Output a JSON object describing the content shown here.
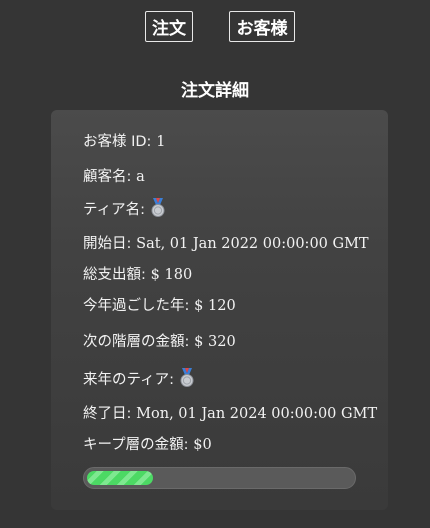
{
  "nav": {
    "orders_label": "注文",
    "customers_label": "お客様"
  },
  "page_title": "注文詳細",
  "details": {
    "customer_id_label": "お客様 ID:",
    "customer_id_value": "1",
    "customer_name_label": "顧客名:",
    "customer_name_value": "a",
    "tier_label": "ティア名:",
    "tier_icon": "silver-medal-icon",
    "start_date_label": "開始日:",
    "start_date_value": "Sat, 01 Jan 2022 00:00:00 GMT",
    "total_spent_label": "総支出額:",
    "total_spent_value": "$ 180",
    "spent_this_year_label": "今年過ごした年:",
    "spent_this_year_value": "$ 120",
    "next_tier_amount_label": "次の階層の金額:",
    "next_tier_amount_value": "$ 320",
    "next_year_tier_label": "来年のティア:",
    "next_year_tier_icon": "silver-medal-icon",
    "end_date_label": "終了日:",
    "end_date_value": "Mon, 01 Jan 2024 00:00:00 GMT",
    "keep_tier_amount_label": "キープ層の金額:",
    "keep_tier_amount_value": "$0"
  },
  "progress": {
    "fraction": 0.25,
    "fill_color": "#4cd964"
  }
}
